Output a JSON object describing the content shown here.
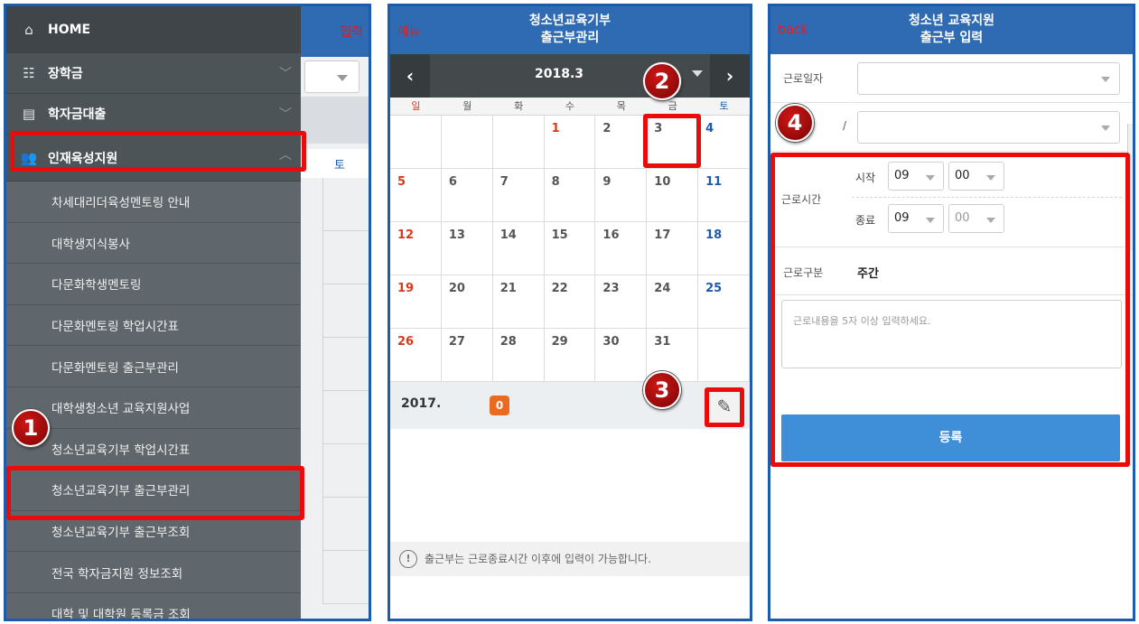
{
  "menu": {
    "bg_header_right": "입력",
    "items": [
      {
        "label": "HOME",
        "icon": "home-icon"
      },
      {
        "label": "장학금",
        "icon": "scholarship-icon"
      },
      {
        "label": "학자금대출",
        "icon": "loan-icon"
      },
      {
        "label": "인재육성지원",
        "icon": "people-icon"
      }
    ],
    "bg_daybar_label": "토",
    "subitems": [
      "차세대리더육성멘토링 안내",
      "대학생지식봉사",
      "다문화학생멘토링",
      "다문화멘토링 학업시간표",
      "다문화멘토링 출근부관리",
      "대학생청소년 교육지원사업",
      "청소년교육기부 학업시간표",
      "청소년교육기부 출근부관리",
      "청소년교육기부 출근부조회",
      "전국 학자금지원 정보조회",
      "대학 및 대학원 등록금 조회"
    ]
  },
  "attendance": {
    "menu_label": "메뉴",
    "title_line1": "청소년교육기부",
    "title_line2": "출근부관리",
    "month": "2018.3",
    "prev": "‹",
    "next": "›",
    "weekdays": [
      "일",
      "월",
      "화",
      "수",
      "목",
      "금",
      "토"
    ],
    "weeks": [
      [
        "",
        "",
        "",
        "1",
        "2",
        "3",
        "4"
      ],
      [
        "5",
        "6",
        "7",
        "8",
        "9",
        "10",
        "11"
      ],
      [
        "12",
        "13",
        "14",
        "15",
        "16",
        "17",
        "18"
      ],
      [
        "19",
        "20",
        "21",
        "22",
        "23",
        "24",
        "25"
      ],
      [
        "26",
        "27",
        "28",
        "29",
        "30",
        "31",
        ""
      ]
    ],
    "count_year": "2017.",
    "count_badge": "0",
    "pen_icon": "✎",
    "notice_icon": "!",
    "notice": "출근부는 근로종료시간 이후에 입력이 가능합니다."
  },
  "entry": {
    "back_label": "back",
    "title_line1": "청소년 교육지원",
    "title_line2": "출근부 입력",
    "date_label": "근로일자",
    "second_label": "/",
    "time_label": "근로시간",
    "start_label": "시작",
    "end_label": "종료",
    "start_hour": "09",
    "start_min": "00",
    "end_hour": "09",
    "end_min": "00",
    "type_label": "근로구분",
    "type_value": "주간",
    "content_placeholder": "근로내용을 5자 이상 입력하세요.",
    "register_button": "등록"
  },
  "markers": [
    "1",
    "2",
    "3",
    "4"
  ],
  "colors": {
    "header_blue": "#2f6bb3",
    "highlight_red": "#ea0b0b",
    "menu_dark": "#4d5458",
    "register_blue": "#3f8fd8",
    "badge_orange": "#ea6b1f"
  }
}
